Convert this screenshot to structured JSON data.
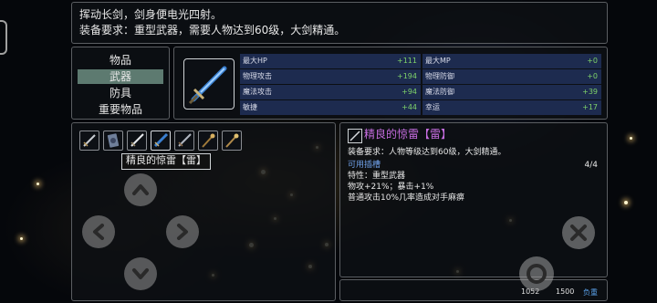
{
  "description": {
    "line1": "挥动长剑，剑身便电光四射。",
    "line2": "装备要求：重型武器，需要人物达到60级，大剑精通。"
  },
  "categories": [
    {
      "label": "物品",
      "selected": false
    },
    {
      "label": "武器",
      "selected": true
    },
    {
      "label": "防具",
      "selected": false
    },
    {
      "label": "重要物品",
      "selected": false
    }
  ],
  "stats": [
    {
      "label": "最大HP",
      "value": "+111"
    },
    {
      "label": "最大MP",
      "value": "+0"
    },
    {
      "label": "物理攻击",
      "value": "+194"
    },
    {
      "label": "物理防御",
      "value": "+0"
    },
    {
      "label": "魔法攻击",
      "value": "+94"
    },
    {
      "label": "魔法防御",
      "value": "+39"
    },
    {
      "label": "敏捷",
      "value": "+44"
    },
    {
      "label": "幸运",
      "value": "+17"
    }
  ],
  "inventory": {
    "slots": [
      "sword-icon",
      "shield-card-icon",
      "sword-icon",
      "lightning-sword-icon",
      "sword-icon",
      "staff-icon",
      "staff-icon"
    ],
    "tooltip": "精良的惊雷【雷】"
  },
  "detail": {
    "name": "精良的惊雷【雷】",
    "requirement": "装备要求：人物等级达到60级，大剑精通。",
    "socket_label": "可用插槽",
    "socket_count": "4/4",
    "trait": "特性：重型武器",
    "bonus": "物攻+21%；暴击+1%",
    "effect": "普通攻击10%几率造成对手麻痹"
  },
  "weight": {
    "current": "1052",
    "max": "1500",
    "label": "负重"
  },
  "colors": {
    "selected_category": "#5d7a70",
    "stat_bg": "#1d2b4f",
    "stat_value": "#7fd36a",
    "item_name": "#c66de0",
    "socket_text": "#6fa0e8",
    "weight_label": "#5aa0e8"
  }
}
